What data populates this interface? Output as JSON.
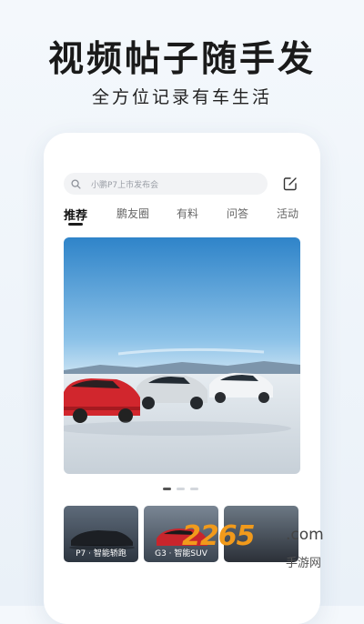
{
  "promo": {
    "headline": "视频帖子随手发",
    "subline": "全方位记录有车生活"
  },
  "search": {
    "placeholder": "小鹏P7上市发布会"
  },
  "icons": {
    "search": "search-icon",
    "edit": "edit-icon"
  },
  "tabs": [
    {
      "label": "推荐",
      "active": true
    },
    {
      "label": "鹏友圈",
      "active": false
    },
    {
      "label": "有料",
      "active": false
    },
    {
      "label": "问答",
      "active": false
    },
    {
      "label": "活动",
      "active": false
    }
  ],
  "carousel": {
    "page_count": 3,
    "active_index": 0
  },
  "cards": [
    {
      "label": "P7 · 智能轿跑"
    },
    {
      "label": "G3 · 智能SUV"
    },
    {
      "label": ""
    }
  ],
  "watermark": {
    "brand": "2265",
    "domain": ".com",
    "sub": "手游网"
  },
  "colors": {
    "accent": "#1c1c1c",
    "background": "#eaf1f8",
    "watermark": "#f19a1b"
  }
}
